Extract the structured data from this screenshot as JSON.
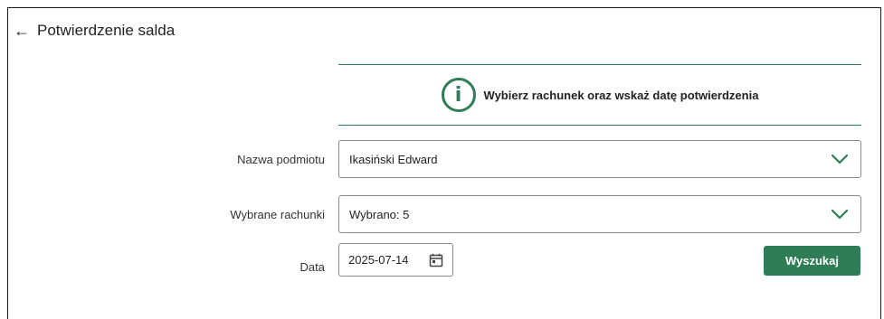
{
  "header": {
    "back_icon": "arrow-left-icon",
    "title": "Potwierdzenie salda"
  },
  "info": {
    "icon": "info-icon",
    "icon_glyph": "i",
    "message": "Wybierz rachunek oraz wskaż datę potwierdzenia"
  },
  "form": {
    "entity": {
      "label": "Nazwa podmiotu",
      "value": "Ikasiński Edward"
    },
    "accounts": {
      "label": "Wybrane rachunki",
      "value": "Wybrano: 5"
    },
    "date": {
      "label": "Data",
      "value": "2025-07-14"
    }
  },
  "actions": {
    "search_label": "Wyszukaj"
  },
  "colors": {
    "accent": "#2e7d57"
  }
}
